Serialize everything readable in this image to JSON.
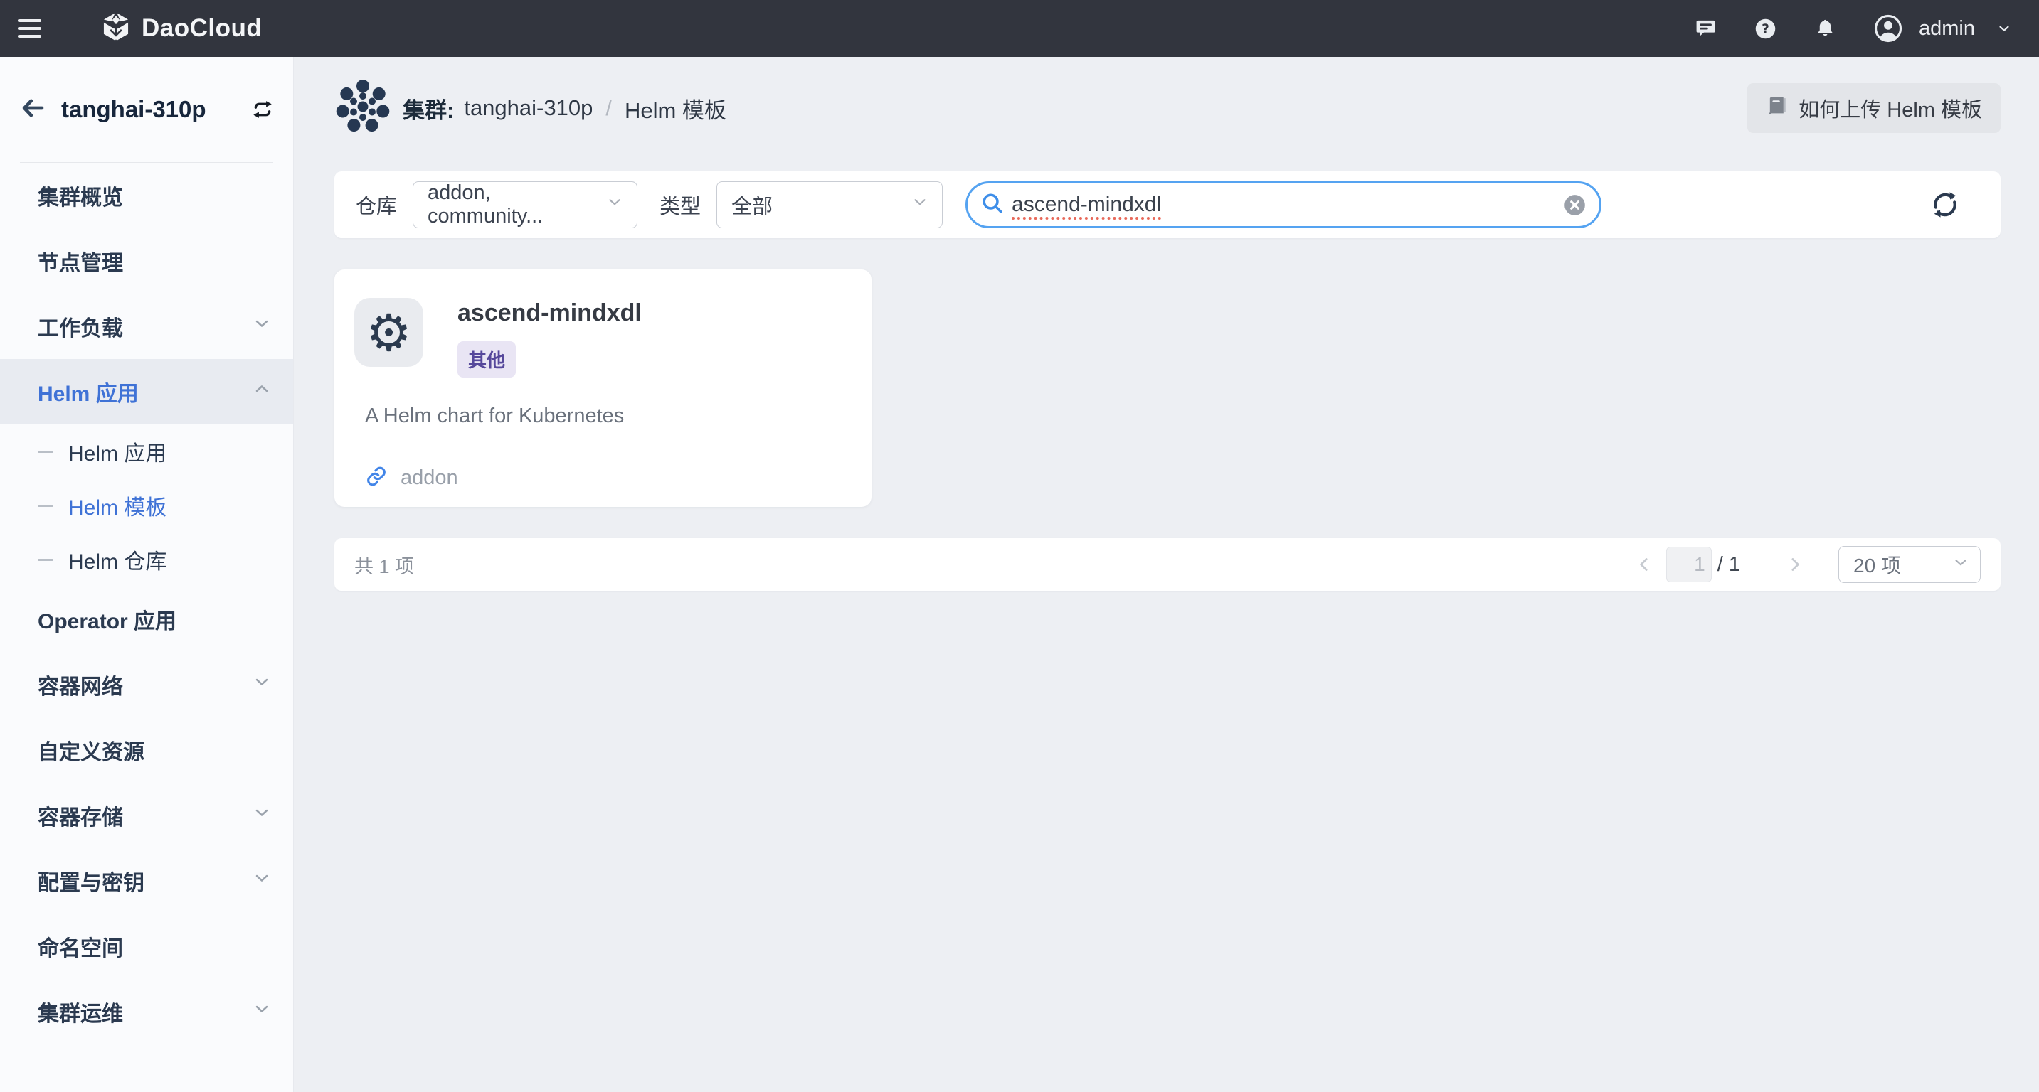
{
  "topbar": {
    "brand": "DaoCloud",
    "user": "admin"
  },
  "sidebar": {
    "cluster_name": "tanghai-310p",
    "items": [
      {
        "label": "集群概览"
      },
      {
        "label": "节点管理"
      },
      {
        "label": "工作负载"
      },
      {
        "label": "Helm 应用"
      },
      {
        "label": "Helm 应用"
      },
      {
        "label": "Helm 模板"
      },
      {
        "label": "Helm 仓库"
      },
      {
        "label": "Operator 应用"
      },
      {
        "label": "容器网络"
      },
      {
        "label": "自定义资源"
      },
      {
        "label": "容器存储"
      },
      {
        "label": "配置与密钥"
      },
      {
        "label": "命名空间"
      },
      {
        "label": "集群运维"
      }
    ]
  },
  "header": {
    "breadcrumb_label": "集群:",
    "cluster": "tanghai-310p",
    "separator": "/",
    "page": "Helm 模板",
    "help_button": "如何上传 Helm 模板"
  },
  "filters": {
    "repo_label": "仓库",
    "repo_value": "addon, community...",
    "type_label": "类型",
    "type_value": "全部",
    "search_value": "ascend-mindxdl"
  },
  "card": {
    "title": "ascend-mindxdl",
    "tag": "其他",
    "description": "A Helm chart for Kubernetes",
    "repo": "addon"
  },
  "pagination": {
    "total": "共 1 项",
    "page": "1",
    "of": "/ 1",
    "page_size": "20 项"
  },
  "colors": {
    "topbar_bg": "#32353e",
    "sidebar_bg": "#fafbfd",
    "main_bg": "#edeff3",
    "accent_blue": "#3f72d6",
    "search_border": "#55a3f1",
    "tag_bg": "#e9e5f4",
    "tag_text": "#56489b"
  },
  "icons": {
    "menu-icon": "hamburger",
    "message-icon": "chat bubble",
    "help-icon": "question circle",
    "bell-icon": "notifications",
    "user-avatar-icon": "person circle",
    "back-icon": "arrow left",
    "swap-cluster-icon": "repeat arrows",
    "cluster-dots-icon": "dot cluster",
    "book-icon": "manual",
    "search-icon": "magnifier",
    "clear-icon": "x circle",
    "refresh-icon": "cycle arrows",
    "gear-icon": "helm chart gear",
    "link-icon": "chain link"
  }
}
